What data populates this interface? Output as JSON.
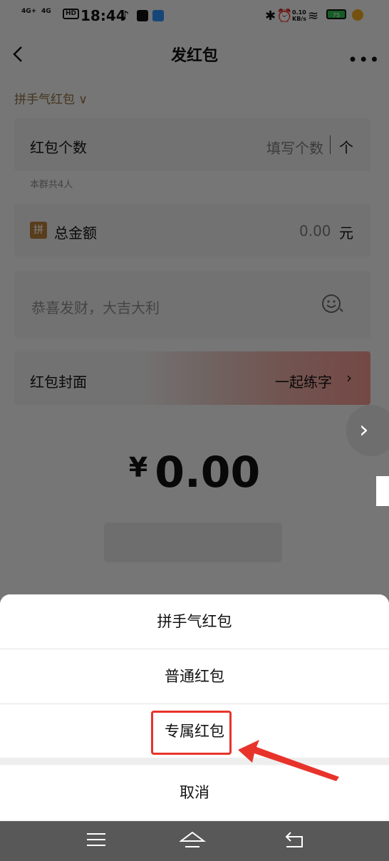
{
  "status_bar": {
    "time": "18:44",
    "network_1": "4G+",
    "network_2": "4G",
    "hd_badge": "HD",
    "speed": "0.10\nKB/s",
    "battery": "75"
  },
  "header": {
    "title": "发红包",
    "more_label": "•••"
  },
  "packet_type": {
    "label": "拼手气红包",
    "chevron": "∨"
  },
  "form": {
    "count_label": "红包个数",
    "count_placeholder": "填写个数",
    "count_unit": "个",
    "count_hint": "本群共4人",
    "amount_icon_text": "拼",
    "amount_label": "总金额",
    "amount_value": "0.00",
    "amount_unit": "元",
    "greeting_placeholder": "恭喜发财，大吉大利",
    "cover_label": "红包封面",
    "cover_value": "一起练字",
    "cover_chevron": "›"
  },
  "total": {
    "currency": "¥",
    "value": "0.00"
  },
  "sheet": {
    "options": [
      "拼手气红包",
      "普通红包",
      "专属红包"
    ],
    "cancel": "取消"
  },
  "colors": {
    "highlight": "#e8332b",
    "accent_brown": "#8a6a3a"
  }
}
